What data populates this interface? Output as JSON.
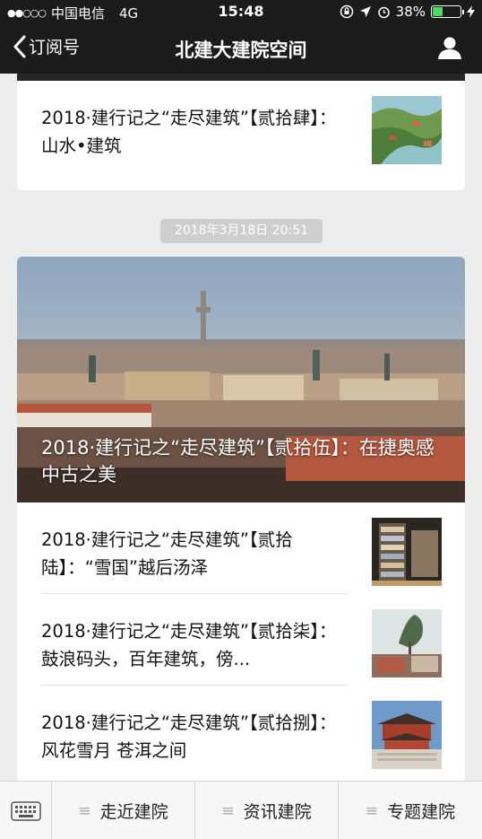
{
  "status_bar": {
    "signal": "●●○○○",
    "carrier": "中国电信",
    "network": "4G",
    "time": "15:48",
    "battery": "38%",
    "battery_level": 0.38
  },
  "nav": {
    "back_label": "订阅号",
    "title": "北建大建院空间"
  },
  "articles_prev": [
    {
      "title": "2018·建行记之“走尽建筑”【贰拾肆】：山水•建筑"
    }
  ],
  "timestamp": "2018年3月18日 20:51",
  "main_article": {
    "title": "2018·建行记之“走尽建筑”【贰拾伍】：在捷奥感中古之美"
  },
  "sub_articles": [
    {
      "title": "2018·建行记之“走尽建筑”【贰拾陆】：“雪国”越后汤泽"
    },
    {
      "title": "2018·建行记之“走尽建筑”【贰拾柒】：鼓浪码头，百年建筑，傍..."
    },
    {
      "title": "2018·建行记之“走尽建筑”【贰拾捌】：风花雪月 苍洱之间"
    }
  ],
  "bottom_menu": {
    "items": [
      {
        "label": "走近建院",
        "icon": "menu-lines-icon"
      },
      {
        "label": "资讯建院",
        "icon": "menu-lines-icon"
      },
      {
        "label": "专题建院",
        "icon": "menu-lines-icon"
      }
    ]
  }
}
